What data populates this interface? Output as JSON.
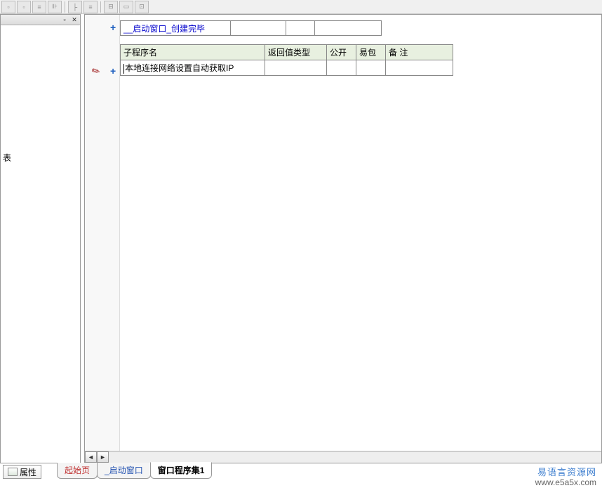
{
  "toolbar": {
    "buttons": [
      "□",
      "□",
      "≡",
      "⊪",
      "├",
      "≡",
      "",
      "⊟",
      "▭",
      "⊡"
    ]
  },
  "left_panel": {
    "char": "表"
  },
  "row1": {
    "name": "__启动窗口_创建完毕",
    "c2": "",
    "c3": "",
    "c4": ""
  },
  "subtable": {
    "headers": {
      "name": "子程序名",
      "ret": "返回值类型",
      "pub": "公开",
      "easy": "易包",
      "note": "备 注"
    },
    "row": {
      "name": "本地连接网络设置自动获取IP",
      "ret": "",
      "pub": "",
      "easy": "",
      "note": ""
    }
  },
  "bottom": {
    "prop": "属性",
    "tabs": [
      "起始页",
      "_启动窗口",
      "窗口程序集1"
    ]
  },
  "watermark": {
    "zh": "易语言资源网",
    "url": "www.e5a5x.com"
  }
}
